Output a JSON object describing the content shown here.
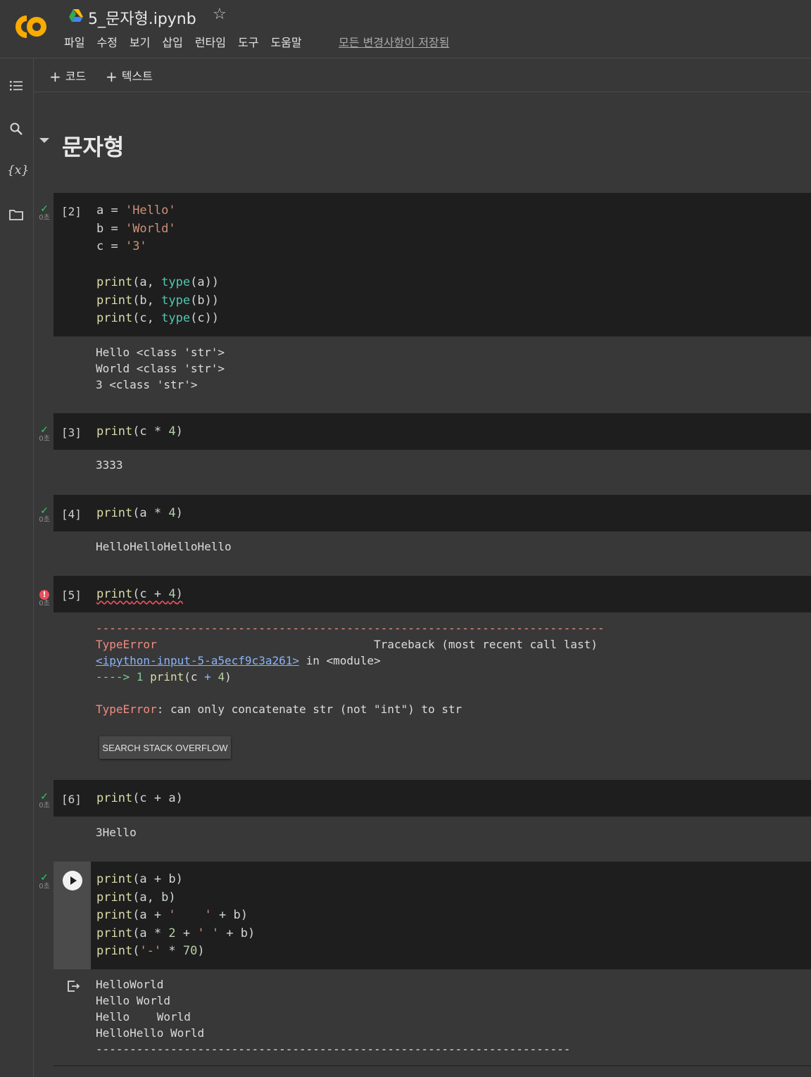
{
  "app": {
    "colors": {
      "accent_orange": "#f9ab00",
      "success": "#2ecc71",
      "error": "#e8505b"
    }
  },
  "header": {
    "title": "5_문자형.ipynb",
    "menu": [
      "파일",
      "수정",
      "보기",
      "삽입",
      "런타임",
      "도구",
      "도움말"
    ],
    "save_status": "모든 변경사항이 저장됨"
  },
  "toolbar": {
    "add_code": "코드",
    "add_text": "텍스트",
    "plus": "+"
  },
  "section": {
    "title": "문자형"
  },
  "cells": {
    "c2": {
      "count": "[2]",
      "duration": "0초",
      "output": "Hello <class 'str'>\nWorld <class 'str'>\n3 <class 'str'>"
    },
    "c3": {
      "count": "[3]",
      "duration": "0초",
      "output": "3333"
    },
    "c4": {
      "count": "[4]",
      "duration": "0초",
      "output": "HelloHelloHelloHello"
    },
    "c5": {
      "count": "[5]",
      "duration": "0초",
      "dashes": "---------------------------------------------------------------------------",
      "error_name": "TypeError",
      "traceback_label": "Traceback (most recent call last)",
      "input_link": "<ipython-input-5-a5ecf9c3a261>",
      "in_module": "in <module>",
      "arrow_line": "----> 1",
      "error_message": ": can only concatenate str (not \"int\") to str",
      "search_button": "SEARCH STACK OVERFLOW"
    },
    "c6": {
      "count": "[6]",
      "duration": "0초",
      "output": "3Hello"
    },
    "c7": {
      "duration": "0초",
      "output": "HelloWorld\nHello World\nHello    World\nHelloHello World\n----------------------------------------------------------------------"
    }
  }
}
